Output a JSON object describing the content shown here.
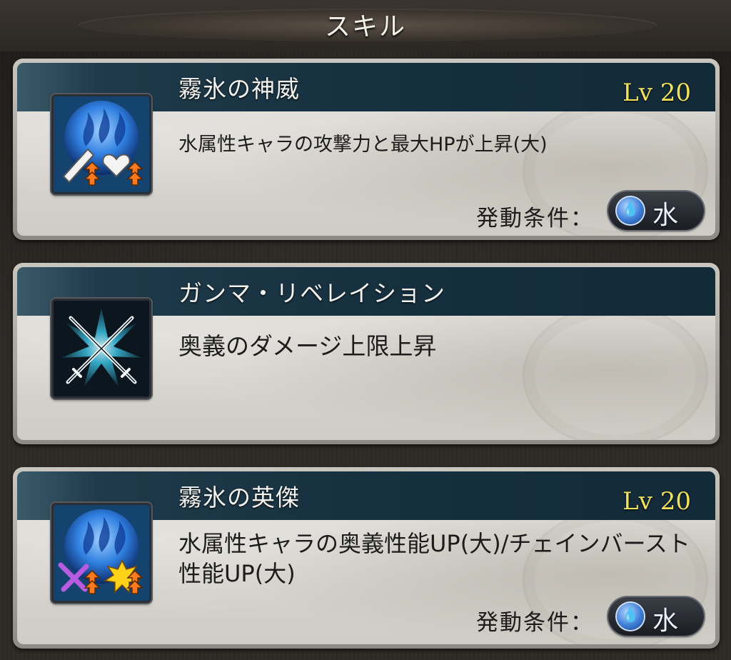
{
  "header": {
    "title": "スキル"
  },
  "skills": [
    {
      "name": "霧氷の神威",
      "level": "Lv 20",
      "description": "水属性キャラの攻撃力と最大HPが上昇(大)",
      "condition_label": "発動条件：",
      "condition_value": "水",
      "icon": "water-atk-hp-up-icon"
    },
    {
      "name": "ガンマ・リベレイション",
      "description": "奥義のダメージ上限上昇",
      "icon": "crossed-swords-icon"
    },
    {
      "name": "霧氷の英傑",
      "level": "Lv 20",
      "description": "水属性キャラの奥義性能UP(大)/チェインバースト性能UP(大)",
      "condition_label": "発動条件：",
      "condition_value": "水",
      "icon": "water-ougi-chain-up-icon"
    }
  ],
  "colors": {
    "level": "#f1e25a",
    "bar": "#16303f",
    "water": "#3e7ed6"
  }
}
